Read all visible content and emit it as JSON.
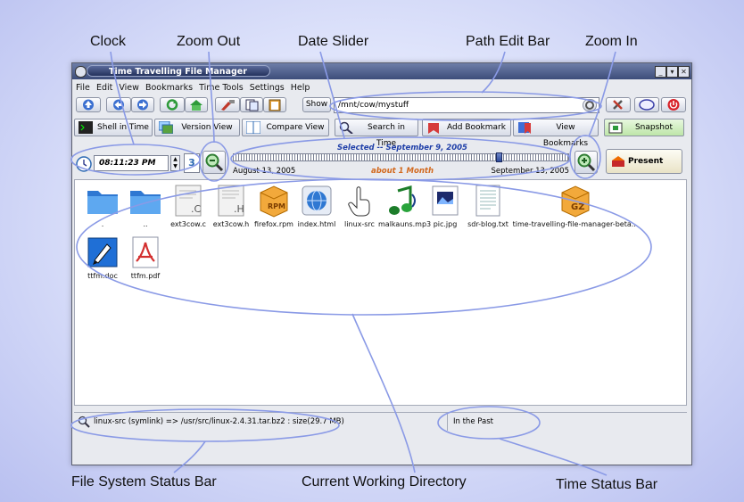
{
  "callouts": {
    "clock": "Clock",
    "zoom_out": "Zoom Out",
    "date_slider": "Date Slider",
    "path_edit_bar": "Path Edit Bar",
    "zoom_in": "Zoom In",
    "fs_status_bar": "File System Status Bar",
    "current_dir": "Current Working Directory",
    "time_status_bar": "Time Status Bar"
  },
  "window": {
    "title": "Time Travelling File Manager"
  },
  "menu": [
    "File",
    "Edit",
    "View",
    "Bookmarks",
    "Time Tools",
    "Settings",
    "Help"
  ],
  "toolbar": {
    "show_label": "Show",
    "path_value": "/mnt/cow/mystuff"
  },
  "tabs": [
    "Shell in Time",
    "Version View",
    "Compare View",
    "Search in Time",
    "Add Bookmark",
    "View Bookmarks",
    "Snapshot"
  ],
  "time_controls": {
    "clock": "08:11:23 PM",
    "calendar_day": "3",
    "selected": "Selected -- September 9, 2005",
    "start": "August 13, 2005",
    "range": "about 1 Month",
    "end": "September 13, 2005",
    "slider_position": 0.8,
    "present_label": "Present Time"
  },
  "files": [
    {
      "name": ".",
      "icon": "folder-icon"
    },
    {
      "name": "..",
      "icon": "folder-icon"
    },
    {
      "name": "ext3cow.c",
      "icon": "c-source-icon"
    },
    {
      "name": "ext3cow.h",
      "icon": "header-file-icon"
    },
    {
      "name": "firefox.rpm",
      "icon": "rpm-package-icon"
    },
    {
      "name": "index.html",
      "icon": "html-file-icon"
    },
    {
      "name": "linux-src",
      "icon": "symlink-hand-icon"
    },
    {
      "name": "malkauns.mp3",
      "icon": "audio-file-icon"
    },
    {
      "name": "pic.jpg",
      "icon": "image-file-icon"
    },
    {
      "name": "sdr-blog.txt",
      "icon": "text-file-icon"
    },
    {
      "name": "time-travelling-file-manager-beta...",
      "icon": "gz-archive-icon"
    },
    {
      "name": "ttfm.doc",
      "icon": "document-icon"
    },
    {
      "name": "ttfm.pdf",
      "icon": "pdf-icon"
    }
  ],
  "status": {
    "fs": "linux-src (symlink) => /usr/src/linux-2.4.31.tar.bz2 : size(29.7 MB)",
    "time": "In the Past"
  },
  "colors": {
    "accent_orange": "#d2691e",
    "selected_blue": "#1f3fa8",
    "callout_line": "#8a9ae6"
  }
}
